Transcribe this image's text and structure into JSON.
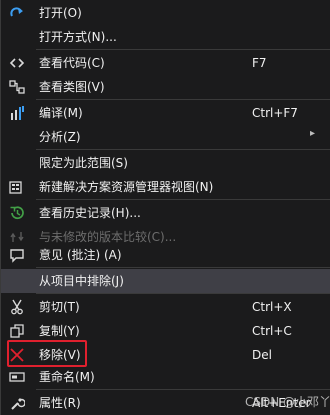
{
  "menu": {
    "items": [
      {
        "label": "打开(O)",
        "shortcut": "",
        "icon": "redo-icon"
      },
      {
        "label": "打开方式(N)...",
        "shortcut": "",
        "icon": ""
      },
      {
        "label": "查看代码(C)",
        "shortcut": "F7",
        "icon": "code-icon"
      },
      {
        "label": "查看类图(V)",
        "shortcut": "",
        "icon": "class-diagram-icon"
      },
      {
        "label": "编译(M)",
        "shortcut": "Ctrl+F7",
        "icon": "compile-icon"
      },
      {
        "label": "分析(Z)",
        "shortcut": "",
        "icon": "",
        "submenu": "▸"
      },
      {
        "label": "限定为此范围(S)",
        "shortcut": "",
        "icon": ""
      },
      {
        "label": "新建解决方案资源管理器视图(N)",
        "shortcut": "",
        "icon": "new-view-icon"
      },
      {
        "label": "查看历史记录(H)...",
        "shortcut": "",
        "icon": "history-icon"
      },
      {
        "label": "与未修改的版本比较(C)...",
        "shortcut": "",
        "icon": "compare-icon",
        "disabled": true
      },
      {
        "label": "意见 (批注) (A)",
        "shortcut": "",
        "icon": "comment-icon"
      },
      {
        "label": "从项目中排除(J)",
        "shortcut": "",
        "icon": ""
      },
      {
        "label": "剪切(T)",
        "shortcut": "Ctrl+X",
        "icon": "scissors-icon"
      },
      {
        "label": "复制(Y)",
        "shortcut": "Ctrl+C",
        "icon": "copy-icon"
      },
      {
        "label": "移除(V)",
        "shortcut": "Del",
        "icon": "remove-icon"
      },
      {
        "label": "重命名(M)",
        "shortcut": "",
        "icon": "rename-icon"
      },
      {
        "label": "属性(R)",
        "shortcut": "Alt+Enter",
        "icon": "wrench-icon"
      }
    ]
  },
  "watermark": "CSDN @小邓丫",
  "colors": {
    "background": "#1b1b1c",
    "highlight": "#3f3f46",
    "text": "#f1f1f1",
    "disabled_text": "#6d6d6d",
    "accent_blue": "#3c9ef2",
    "remove_red": "#e0202e",
    "history_green": "#43a047"
  }
}
